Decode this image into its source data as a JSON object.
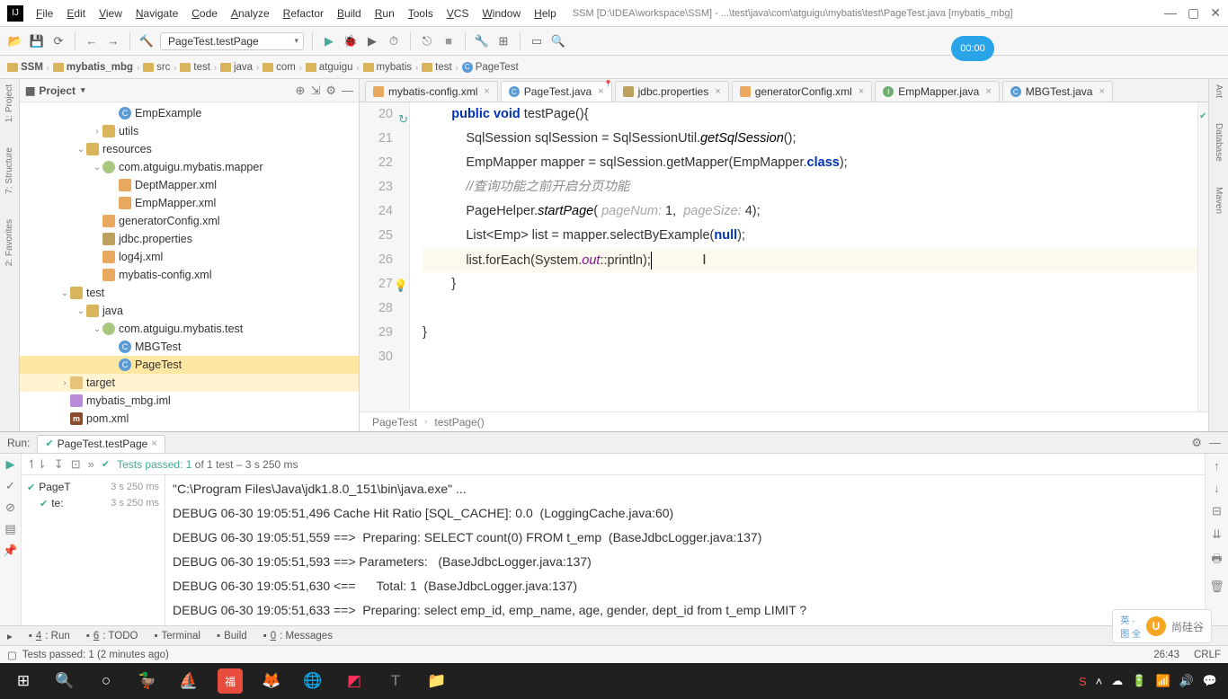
{
  "window": {
    "title": "SSM [D:\\IDEA\\workspace\\SSM] - ...\\test\\java\\com\\atguigu\\mybatis\\test\\PageTest.java [mybatis_mbg]",
    "timer": "00:00"
  },
  "menus": [
    "File",
    "Edit",
    "View",
    "Navigate",
    "Code",
    "Analyze",
    "Refactor",
    "Build",
    "Run",
    "Tools",
    "VCS",
    "Window",
    "Help"
  ],
  "runConfig": "PageTest.testPage",
  "breadcrumb": [
    "SSM",
    "mybatis_mbg",
    "src",
    "test",
    "java",
    "com",
    "atguigu",
    "mybatis",
    "test",
    "PageTest"
  ],
  "projectHeader": "Project",
  "tree": [
    {
      "indent": 4,
      "exp": "",
      "ico": "class",
      "label": "EmpExample"
    },
    {
      "indent": 3,
      "exp": "›",
      "ico": "folder",
      "label": "utils"
    },
    {
      "indent": 2,
      "exp": "⌄",
      "ico": "folder",
      "label": "resources"
    },
    {
      "indent": 3,
      "exp": "⌄",
      "ico": "pkg",
      "label": "com.atguigu.mybatis.mapper"
    },
    {
      "indent": 4,
      "exp": "",
      "ico": "xml",
      "label": "DeptMapper.xml"
    },
    {
      "indent": 4,
      "exp": "",
      "ico": "xml",
      "label": "EmpMapper.xml"
    },
    {
      "indent": 3,
      "exp": "",
      "ico": "xml",
      "label": "generatorConfig.xml"
    },
    {
      "indent": 3,
      "exp": "",
      "ico": "prop",
      "label": "jdbc.properties"
    },
    {
      "indent": 3,
      "exp": "",
      "ico": "xml",
      "label": "log4j.xml"
    },
    {
      "indent": 3,
      "exp": "",
      "ico": "xml",
      "label": "mybatis-config.xml"
    },
    {
      "indent": 1,
      "exp": "⌄",
      "ico": "folder",
      "label": "test"
    },
    {
      "indent": 2,
      "exp": "⌄",
      "ico": "folder",
      "label": "java"
    },
    {
      "indent": 3,
      "exp": "⌄",
      "ico": "pkg",
      "label": "com.atguigu.mybatis.test"
    },
    {
      "indent": 4,
      "exp": "",
      "ico": "class",
      "label": "MBGTest"
    },
    {
      "indent": 4,
      "exp": "",
      "ico": "class",
      "label": "PageTest",
      "sel": true
    },
    {
      "indent": 1,
      "exp": "›",
      "ico": "folder-o",
      "label": "target",
      "hl": true
    },
    {
      "indent": 1,
      "exp": "",
      "ico": "iml",
      "label": "mybatis_mbg.iml"
    },
    {
      "indent": 1,
      "exp": "",
      "ico": "pom",
      "label": "pom.xml"
    }
  ],
  "editorTabs": [
    {
      "ico": "xml",
      "label": "mybatis-config.xml"
    },
    {
      "ico": "class",
      "label": "PageTest.java",
      "active": true,
      "pinned": true
    },
    {
      "ico": "prop",
      "label": "jdbc.properties"
    },
    {
      "ico": "xml",
      "label": "generatorConfig.xml"
    },
    {
      "ico": "iface",
      "label": "EmpMapper.java"
    },
    {
      "ico": "class",
      "label": "MBGTest.java"
    }
  ],
  "lineStart": 20,
  "code": {
    "l20_kw1": "public",
    "l20_kw2": "void",
    "l20_rest": " testPage(){",
    "l21": "            SqlSession sqlSession = SqlSessionUtil.",
    "l21_m": "getSqlSession",
    "l21_e": "();",
    "l22_a": "            EmpMapper mapper = sqlSession.getMapper(EmpMapper.",
    "l22_kw": "class",
    "l22_e": ");",
    "l23": "            //查询功能之前开启分页功能",
    "l24_a": "            PageHelper.",
    "l24_m": "startPage",
    "l24_b": "( ",
    "l24_h1": "pageNum:",
    "l24_v1": " 1,  ",
    "l24_h2": "pageSize:",
    "l24_v2": " 4);",
    "l25_a": "            List<Emp> list = mapper.selectByExample(",
    "l25_n": "null",
    "l25_e": ");",
    "l26_a": "            list.forEach(System.",
    "l26_f": "out",
    "l26_b": "::println);",
    "l27": "        }",
    "l28": "",
    "l29": "}",
    "l30": ""
  },
  "crumbs": [
    "PageTest",
    "testPage()"
  ],
  "run": {
    "label": "Run:",
    "tab": "PageTest.testPage",
    "passedLabel": "Tests passed: 1",
    "passedOf": " of 1 test – 3 s 250 ms",
    "tests": [
      {
        "name": "PageT",
        "time": "3 s 250 ms"
      },
      {
        "name": "te:",
        "time": "3 s 250 ms",
        "indent": true
      }
    ],
    "console": [
      "\"C:\\Program Files\\Java\\jdk1.8.0_151\\bin\\java.exe\" ...",
      "DEBUG 06-30 19:05:51,496 Cache Hit Ratio [SQL_CACHE]: 0.0  (LoggingCache.java:60)",
      "DEBUG 06-30 19:05:51,559 ==>  Preparing: SELECT count(0) FROM t_emp  (BaseJdbcLogger.java:137)",
      "DEBUG 06-30 19:05:51,593 ==> Parameters:   (BaseJdbcLogger.java:137)",
      "DEBUG 06-30 19:05:51,630 <==      Total: 1  (BaseJdbcLogger.java:137)",
      "DEBUG 06-30 19:05:51,633 ==>  Preparing: select emp_id, emp_name, age, gender, dept_id from t_emp LIMIT ?"
    ]
  },
  "bottomTabs": [
    {
      "key": "4",
      "label": "Run",
      "underline": "R"
    },
    {
      "key": "6",
      "label": "TODO",
      "underline": "6"
    },
    {
      "key": "",
      "label": "Terminal",
      "underline": "T"
    },
    {
      "key": "",
      "label": "Build",
      "underline": "B"
    },
    {
      "key": "0",
      "label": "Messages",
      "underline": "0"
    }
  ],
  "status": {
    "msg": "Tests passed: 1 (2 minutes ago)",
    "pos": "26:43",
    "eol": "CRLF"
  },
  "watermark": {
    "brand": "尚硅谷",
    "small": "英 ·\n图 全"
  },
  "leftStrip": [
    "1: Project",
    "7: Structure",
    "2: Favorites"
  ],
  "rightStrip": [
    "Ant",
    "Database",
    "Maven"
  ]
}
